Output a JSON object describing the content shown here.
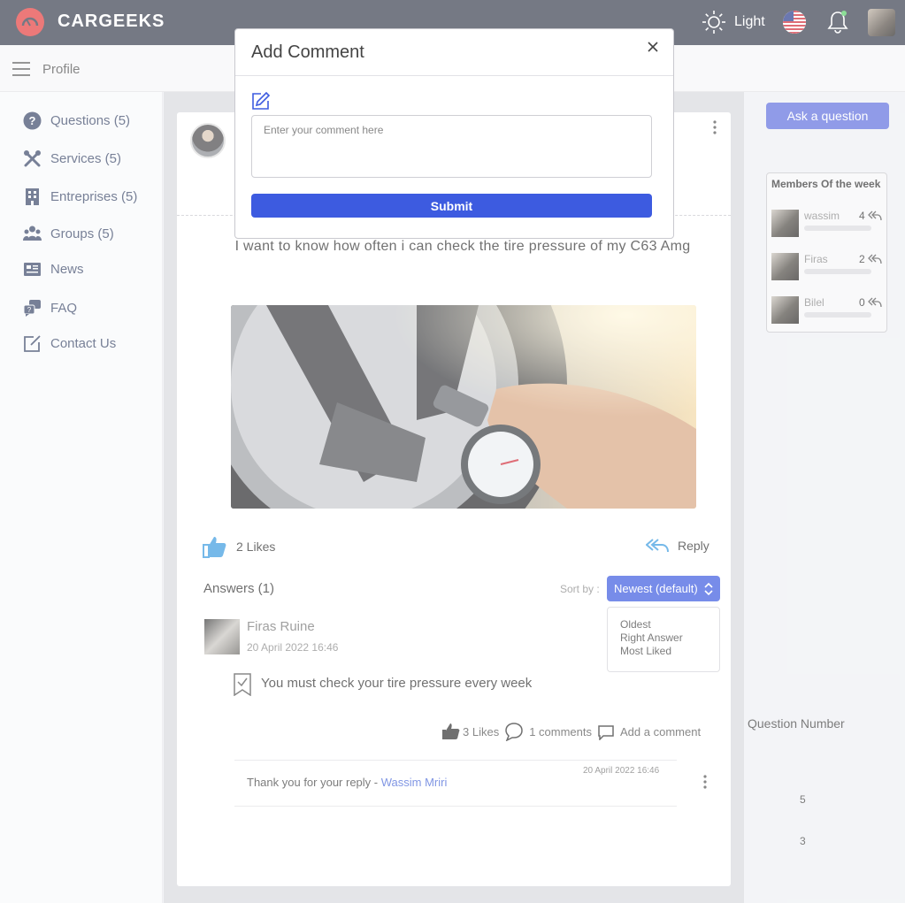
{
  "header": {
    "brand": "CARGEEKS",
    "theme_label": "Light"
  },
  "subheader": {
    "crumb": "Profile"
  },
  "sidebar": {
    "items": [
      {
        "label": "Questions (5)",
        "icon": "question-circle-icon"
      },
      {
        "label": "Services (5)",
        "icon": "tools-icon"
      },
      {
        "label": "Entreprises (5)",
        "icon": "building-icon"
      },
      {
        "label": "Groups (5)",
        "icon": "users-icon"
      },
      {
        "label": "News",
        "icon": "newspaper-icon"
      },
      {
        "label": "FAQ",
        "icon": "chat-help-icon"
      },
      {
        "label": "Contact Us",
        "icon": "edit-box-icon"
      }
    ]
  },
  "question": {
    "text": "I want to know how often i can check the tire pressure of my C63 Amg",
    "likes": "2 Likes",
    "reply_label": "Reply"
  },
  "answers": {
    "title": "Answers (1)",
    "sort_label": "Sort by :",
    "sort_selected": "Newest (default)",
    "sort_options": [
      "Oldest",
      "Right Answer",
      "Most Liked"
    ],
    "items": [
      {
        "author": "Firas Ruine",
        "date": "20 April 2022 16:46",
        "text": "You must check your tire pressure every week",
        "likes": "3 Likes",
        "comments_count": "1 comments",
        "add_comment": "Add a comment",
        "comments": [
          {
            "text": "Thank you for your reply - ",
            "author": "Wassim Mriri",
            "date": "20 April 2022 16:46"
          }
        ]
      }
    ]
  },
  "right": {
    "ask_button": "Ask a question",
    "members_title": "Members Of the week",
    "members": [
      {
        "name": "wassim",
        "count": "4"
      },
      {
        "name": "Firas",
        "count": "2"
      },
      {
        "name": "Bilel",
        "count": "0"
      }
    ],
    "question_number_title": "Question Number",
    "question_number_values": [
      "5",
      "3"
    ]
  },
  "modal": {
    "title": "Add Comment",
    "placeholder": "Enter your comment here",
    "submit_label": "Submit"
  },
  "colors": {
    "header_bg": "#3a3f50",
    "accent": "#3d5be0",
    "logo_red": "#e4403f",
    "link_blue": "#4a69d8"
  }
}
